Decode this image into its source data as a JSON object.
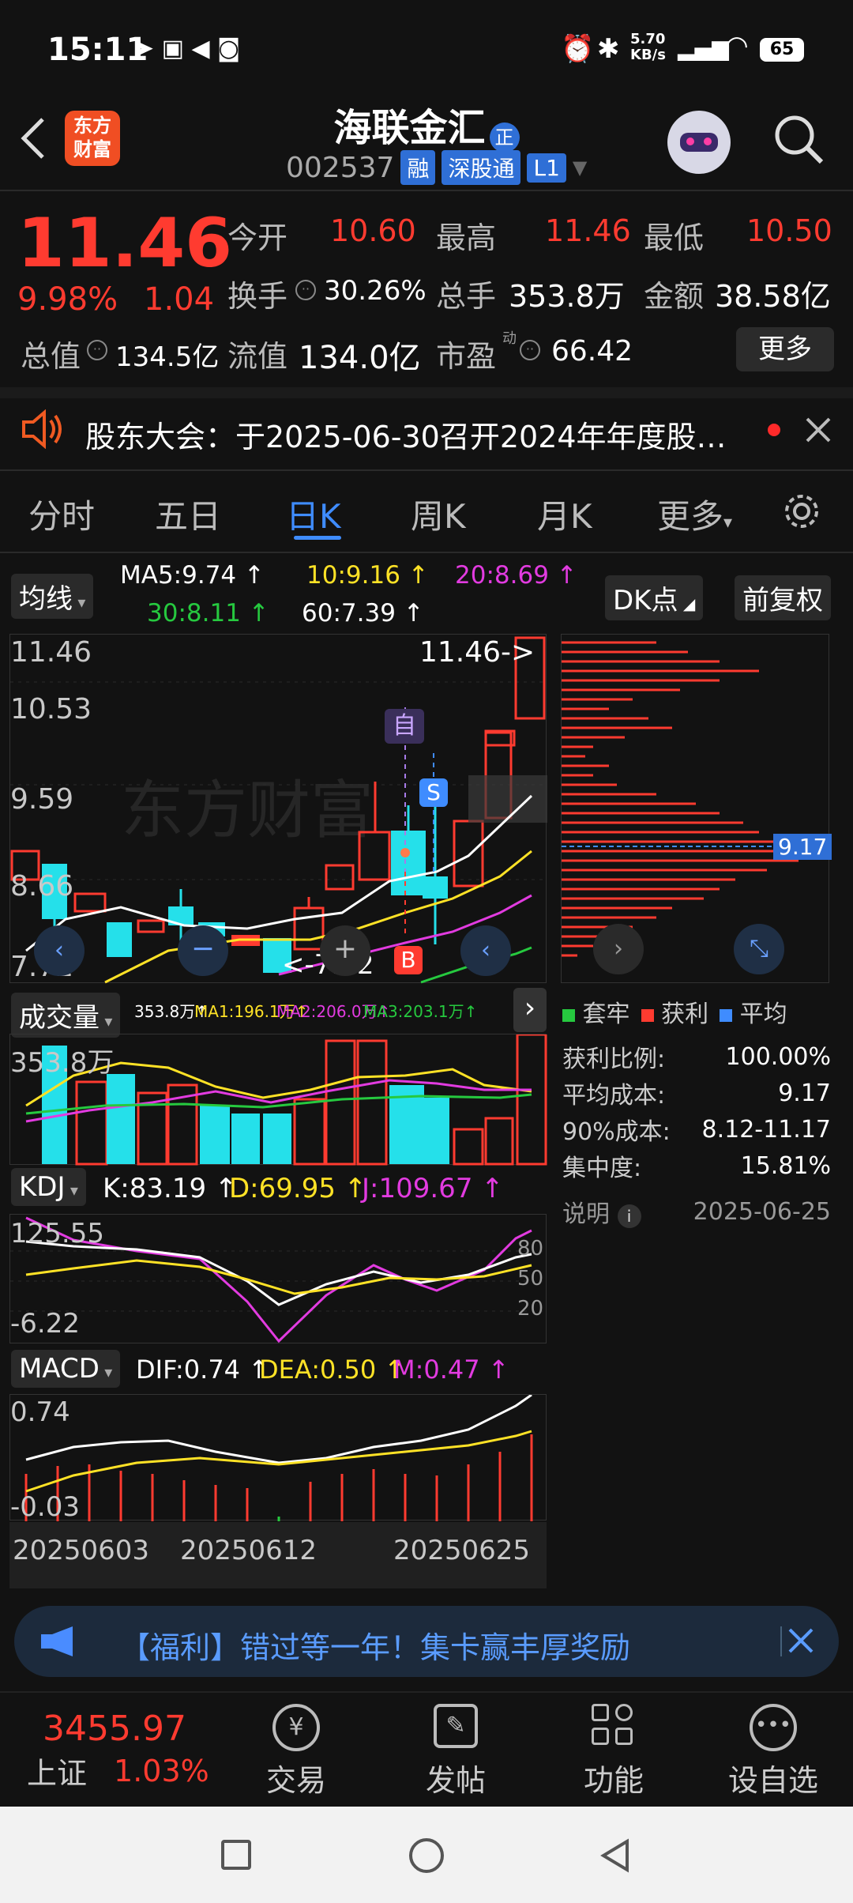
{
  "status_bar": {
    "time": "15:11",
    "net_speed": "5.70\nKB/s",
    "battery": "65"
  },
  "header": {
    "logo_text": "东方\n财富",
    "title": "海联金汇",
    "title_badge": "正",
    "code": "002537",
    "tags": [
      "融",
      "深股通",
      "L1"
    ]
  },
  "quote": {
    "price": "11.46",
    "change_pct": "9.98%",
    "change": "1.04",
    "open_label": "今开",
    "open": "10.60",
    "high_label": "最高",
    "high": "11.46",
    "low_label": "最低",
    "low": "10.50",
    "turnover_label": "换手",
    "turnover": "30.26%",
    "volume_label": "总手",
    "volume": "353.8万",
    "amount_label": "金额",
    "amount": "38.58亿",
    "mktcap_label": "总值",
    "mktcap": "134.5亿",
    "float_label": "流值",
    "float": "134.0亿",
    "pe_label": "市盈",
    "pe_sup": "动",
    "pe": "66.42",
    "more": "更多"
  },
  "notice": {
    "text": "股东大会：于2025-06-30召开2024年年度股…"
  },
  "tabs": [
    "分时",
    "五日",
    "日K",
    "周K",
    "月K",
    "更多"
  ],
  "active_tab": 2,
  "ma": {
    "label": "均线",
    "ma5": "MA5:9.74 ↑",
    "ma10": "10:9.16 ↑",
    "ma20": "20:8.69 ↑",
    "ma30": "30:8.11 ↑",
    "ma60": "60:7.39 ↑",
    "dk": "DK点",
    "adjust": "前复权"
  },
  "kline": {
    "ticks": [
      "11.46",
      "10.53",
      "9.59",
      "8.66",
      "7.72"
    ],
    "max_label": "11.46->",
    "min_label": "<-7.72",
    "marker_self": "自",
    "marker_s": "S",
    "marker_b": "B",
    "watermark": "东方财富"
  },
  "chips": {
    "avg_label": "9.17",
    "legend": [
      "套牢",
      "获利",
      "平均"
    ],
    "rows": [
      {
        "k": "获利比例:",
        "v": "100.00%"
      },
      {
        "k": "平均成本:",
        "v": "9.17"
      },
      {
        "k": "90%成本:",
        "v": "8.12-11.17"
      },
      {
        "k": "集中度:",
        "v": "15.81%"
      }
    ],
    "note_label": "说明",
    "date": "2025-06-25"
  },
  "volume": {
    "label": "成交量",
    "v": "353.8万↑",
    "ma1": "MA1:196.1万↑",
    "ma2": "MA2:206.0万↑",
    "ma3": "MA3:203.1万↑",
    "tick": "353.8万"
  },
  "kdj": {
    "label": "KDJ",
    "k": "K:83.19 ↑",
    "d": "D:69.95 ↑",
    "j": "J:109.67 ↑",
    "top": "125.55",
    "bottom": "-6.22",
    "levels": [
      "80",
      "50",
      "20"
    ]
  },
  "macd": {
    "label": "MACD",
    "dif": "DIF:0.74 ↑",
    "dea": "DEA:0.50 ↑",
    "m": "M:0.47 ↑",
    "top": "0.74",
    "bottom": "-0.03",
    "dates": [
      "20250603",
      "20250612",
      "20250625"
    ]
  },
  "banner": {
    "text": "【福利】错过等一年！集卡赢丰厚奖励"
  },
  "bottom_nav": {
    "index_value": "3455.97",
    "index_name": "上证",
    "index_pct": "1.03%",
    "items": [
      "交易",
      "发帖",
      "功能",
      "设自选"
    ]
  },
  "colors": {
    "up": "#ff3b30",
    "down": "#25e0ea",
    "accent": "#3f8cff"
  }
}
